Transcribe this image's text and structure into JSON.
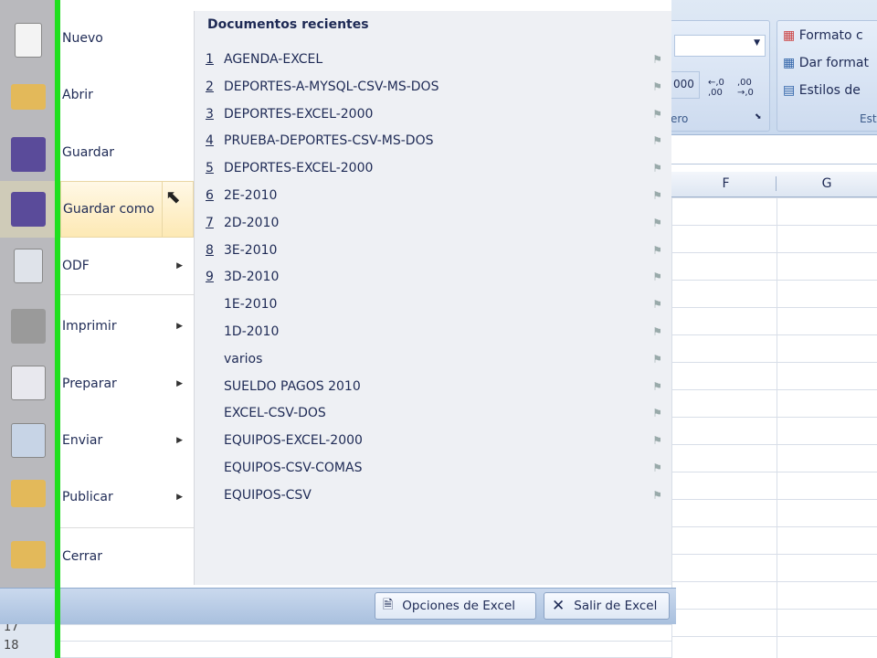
{
  "menu": {
    "items": [
      {
        "label": "Nuevo",
        "icon": "new-document-icon"
      },
      {
        "label": "Abrir",
        "icon": "open-folder-icon"
      },
      {
        "label": "Guardar",
        "icon": "save-icon"
      },
      {
        "label": "Guardar como",
        "icon": "save-as-icon",
        "highlighted": true
      },
      {
        "label": "ODF",
        "icon": "odf-icon",
        "submenu": true
      },
      {
        "label": "Imprimir",
        "icon": "printer-icon",
        "submenu": true
      },
      {
        "label": "Preparar",
        "icon": "prepare-icon",
        "submenu": true
      },
      {
        "label": "Enviar",
        "icon": "send-icon",
        "submenu": true
      },
      {
        "label": "Publicar",
        "icon": "publish-icon",
        "submenu": true
      },
      {
        "label": "Cerrar",
        "icon": "close-folder-icon"
      }
    ]
  },
  "recent": {
    "title": "Documentos recientes",
    "items": [
      {
        "num": "1",
        "name": "AGENDA-EXCEL"
      },
      {
        "num": "2",
        "name": "DEPORTES-A-MYSQL-CSV-MS-DOS"
      },
      {
        "num": "3",
        "name": "DEPORTES-EXCEL-2000"
      },
      {
        "num": "4",
        "name": "PRUEBA-DEPORTES-CSV-MS-DOS"
      },
      {
        "num": "5",
        "name": "DEPORTES-EXCEL-2000"
      },
      {
        "num": "6",
        "name": "2E-2010"
      },
      {
        "num": "7",
        "name": "2D-2010"
      },
      {
        "num": "8",
        "name": "3E-2010"
      },
      {
        "num": "9",
        "name": "3D-2010"
      },
      {
        "num": "",
        "name": "1E-2010"
      },
      {
        "num": "",
        "name": "1D-2010"
      },
      {
        "num": "",
        "name": "varios"
      },
      {
        "num": "",
        "name": "SUELDO PAGOS 2010"
      },
      {
        "num": "",
        "name": "EXCEL-CSV-DOS"
      },
      {
        "num": "",
        "name": "EQUIPOS-EXCEL-2000"
      },
      {
        "num": "",
        "name": "EQUIPOS-CSV-COMAS"
      },
      {
        "num": "",
        "name": "EQUIPOS-CSV"
      }
    ]
  },
  "footer": {
    "options": "Opciones de Excel",
    "exit": "Salir de Excel"
  },
  "ribbon": {
    "styles": [
      "Formato c",
      "Dar format",
      "Estilos de"
    ],
    "group_number": "ero",
    "group_styles": "Est",
    "thousands": "000",
    "dec_inc": "←,0 ,00",
    "dec_dec": ",00 →,0"
  },
  "sheet": {
    "columns": [
      "F",
      "G"
    ],
    "rows": [
      "17",
      "18"
    ]
  }
}
